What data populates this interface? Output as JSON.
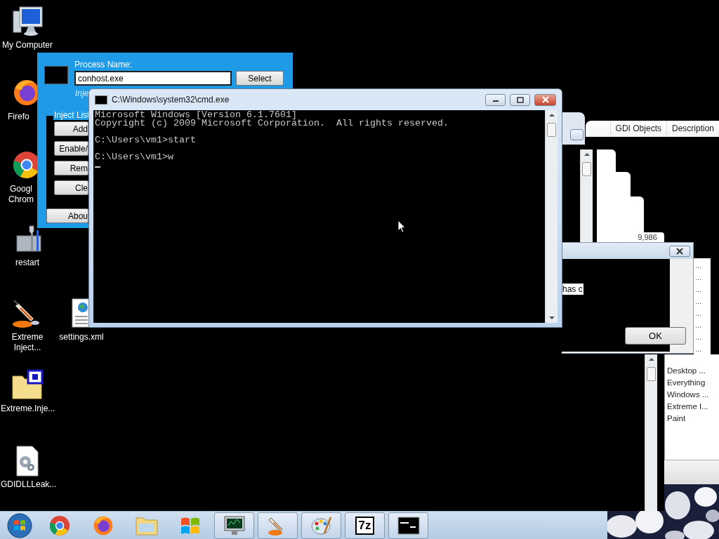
{
  "desktop_icons": [
    {
      "kind": "computer",
      "label": "My Computer"
    },
    {
      "kind": "firefox",
      "label": "Firefo"
    },
    {
      "kind": "chrome",
      "label": "Googl Chrom"
    },
    {
      "kind": "toolbox",
      "label": "restart"
    },
    {
      "kind": "syringe",
      "label": "Extreme Inject..."
    },
    {
      "kind": "xml",
      "label": "settings.xml"
    },
    {
      "kind": "folder",
      "label": "Extreme.Inje..."
    },
    {
      "kind": "gearfile",
      "label": "GDIDLLLeak..."
    }
  ],
  "injector": {
    "process_label": "Process Name:",
    "process_value": "conhost.exe",
    "select": "Select",
    "hint": "Inje",
    "group_title": "Inject List",
    "buttons": [
      "Add",
      "Enable/",
      "Rem",
      "Cle"
    ],
    "about": "Abou"
  },
  "console": {
    "title": "C:\\Windows\\system32\\cmd.exe",
    "blocks": [
      [
        "Microsoft Windows [Version 6.1.7601]",
        "Copyright (c) 2009 Microsoft Corporation.  All rights reserved."
      ],
      [
        "C:\\Users\\vm1>start"
      ],
      [
        "C:\\Users\\vm1>w"
      ]
    ]
  },
  "background_windows": {
    "columns": [
      "GDI Objects",
      "Description"
    ],
    "value": "9,986",
    "dialog_text": "has c",
    "ok": "OK",
    "ellipsis_rows": [
      "...",
      "...",
      "...",
      "...",
      "...",
      "...",
      "...",
      "..."
    ],
    "list_items": [
      "Desktop ...",
      "Everything",
      "Windows ...",
      "Extreme I...",
      "Paint"
    ]
  },
  "taskbar": {
    "items": [
      {
        "kind": "start",
        "running": false
      },
      {
        "kind": "chrome",
        "running": false
      },
      {
        "kind": "firefox",
        "running": false
      },
      {
        "kind": "folder",
        "running": false
      },
      {
        "kind": "windows",
        "running": false
      },
      {
        "kind": "monitor",
        "running": true
      },
      {
        "kind": "syringe",
        "running": true
      },
      {
        "kind": "palette",
        "running": true
      },
      {
        "kind": "archive",
        "label": "7z",
        "running": true
      },
      {
        "kind": "console",
        "running": true
      }
    ]
  }
}
